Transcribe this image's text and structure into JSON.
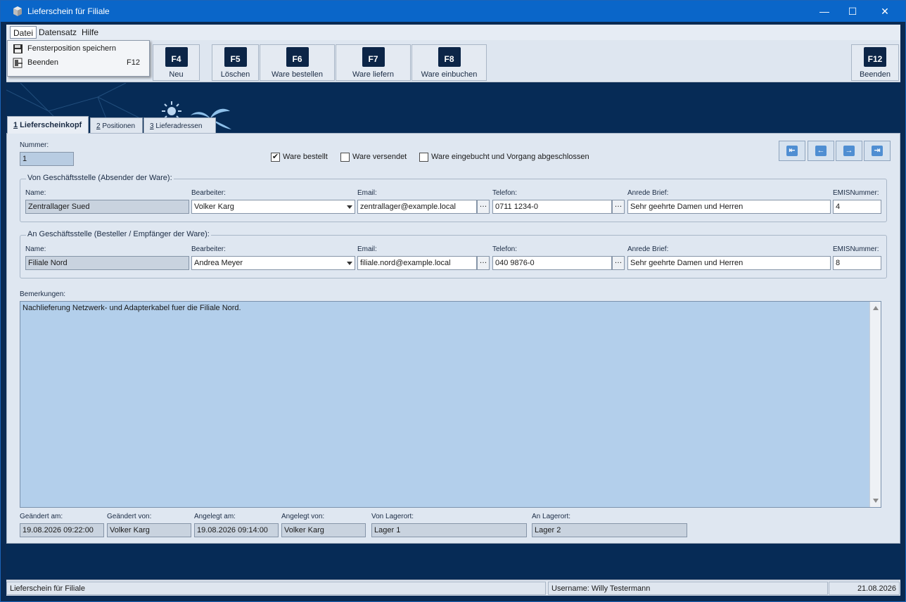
{
  "window": {
    "title": "Lieferschein für Filiale",
    "controls": {
      "minimize": "—",
      "maximize": "☐",
      "close": "✕"
    }
  },
  "menu": {
    "items": [
      "Datei",
      "Datensatz",
      "Hilfe"
    ],
    "datei_dropdown": [
      {
        "label": "Fensterposition speichern",
        "shortcut": "",
        "icon": "floppy-disk-icon"
      },
      {
        "label": "Beenden",
        "shortcut": "F12",
        "icon": "exit-icon"
      }
    ]
  },
  "toolbar": {
    "buttons": [
      {
        "key": "F4",
        "label": "Neu"
      },
      {
        "key": "F5",
        "label": "Löschen"
      },
      {
        "key": "F6",
        "label": "Ware bestellen"
      },
      {
        "key": "F7",
        "label": "Ware liefern"
      },
      {
        "key": "F8",
        "label": "Ware einbuchen"
      },
      {
        "key": "F12",
        "label": "Beenden"
      }
    ]
  },
  "tabs": [
    {
      "num": "1",
      "label": " Lieferscheinkopf"
    },
    {
      "num": "2",
      "label": " Positionen"
    },
    {
      "num": "3",
      "label": " Lieferadressen"
    }
  ],
  "form": {
    "nummer_label": "Nummer:",
    "nummer_value": "1",
    "checkboxes": [
      {
        "label": "Ware bestellt",
        "checked": true
      },
      {
        "label": "Ware versendet",
        "checked": false
      },
      {
        "label": "Ware eingebucht und Vorgang abgeschlossen",
        "checked": false
      }
    ],
    "nav_buttons": [
      "first",
      "prev",
      "next",
      "last"
    ],
    "labels": {
      "name": "Name:",
      "bearbeiter": "Bearbeiter:",
      "email": "Email:",
      "telefon": "Telefon:",
      "anrede": "Anrede Brief:",
      "emis": "EMISNummer:"
    },
    "von": {
      "title": "Von Geschäftsstelle (Absender der Ware):",
      "name": "Zentrallager Sued",
      "bearbeiter": "Volker Karg",
      "email": "zentrallager@example.local",
      "telefon": "0711 1234-0",
      "anrede": "Sehr geehrte Damen und Herren",
      "emis": "4"
    },
    "an": {
      "title": "An Geschäftsstelle (Besteller / Empfänger der Ware):",
      "name": "Filiale Nord",
      "bearbeiter": "Andrea Meyer",
      "email": "filiale.nord@example.local",
      "telefon": "040 9876-0",
      "anrede": "Sehr geehrte Damen und Herren",
      "emis": "8"
    },
    "bemerkungen_label": "Bemerkungen:",
    "bemerkungen": "Nachlieferung Netzwerk- und Adapterkabel fuer die Filiale Nord.",
    "footer": [
      {
        "label": "Geändert am:",
        "value": "19.08.2026 09:22:00"
      },
      {
        "label": "Geändert von:",
        "value": "Volker Karg"
      },
      {
        "label": "Angelegt am:",
        "value": "19.08.2026 09:14:00"
      },
      {
        "label": "Angelegt von:",
        "value": "Volker Karg"
      },
      {
        "label": "Von Lagerort:",
        "value": "Lager 1"
      },
      {
        "label": "An Lagerort:",
        "value": "Lager 2"
      }
    ]
  },
  "statusbar": {
    "left": "Lieferschein für Filiale",
    "user": "Username: Willy Testermann",
    "date": "21.08.2026"
  },
  "colors": {
    "titlebar": "#0a66c9",
    "banner": "#062b56",
    "key_badge": "#0c2547",
    "memo_bg": "#b3cfeb"
  }
}
